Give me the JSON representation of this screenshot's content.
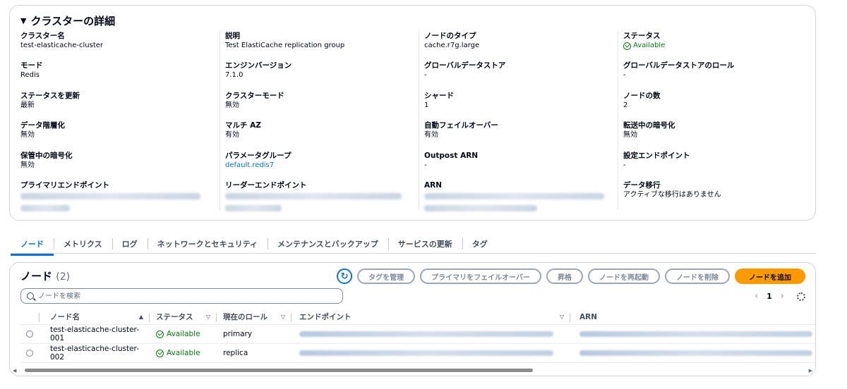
{
  "details": {
    "title": "クラスターの詳細",
    "columns": [
      [
        {
          "label": "クラスター名",
          "value": "test-elasticache-cluster"
        },
        {
          "label": "モード",
          "value": "Redis"
        },
        {
          "label": "ステータスを更新",
          "value": "最新"
        },
        {
          "label": "データ階層化",
          "value": "無効"
        },
        {
          "label": "保管中の暗号化",
          "value": "無効"
        },
        {
          "label": "プライマリエンドポイント",
          "value": ""
        }
      ],
      [
        {
          "label": "説明",
          "value": "Test ElastiCache replication group"
        },
        {
          "label": "エンジンバージョン",
          "value": "7.1.0"
        },
        {
          "label": "クラスターモード",
          "value": "無効"
        },
        {
          "label": "マルチ AZ",
          "value": "有効"
        },
        {
          "label": "パラメータグループ",
          "value": "default.redis7"
        },
        {
          "label": "リーダーエンドポイント",
          "value": ""
        }
      ],
      [
        {
          "label": "ノードのタイプ",
          "value": "cache.r7g.large"
        },
        {
          "label": "グローバルデータストア",
          "value": "-"
        },
        {
          "label": "シャード",
          "value": "1"
        },
        {
          "label": "自動フェイルオーバー",
          "value": "有効"
        },
        {
          "label": "Outpost ARN",
          "value": "-"
        },
        {
          "label": "ARN",
          "value": ""
        }
      ],
      [
        {
          "label": "ステータス",
          "value": "Available"
        },
        {
          "label": "グローバルデータストアのロール",
          "value": "-"
        },
        {
          "label": "ノードの数",
          "value": "2"
        },
        {
          "label": "転送中の暗号化",
          "value": "無効"
        },
        {
          "label": "設定エンドポイント",
          "value": "-"
        },
        {
          "label": "データ移行",
          "value": "アクティブな移行はありません"
        }
      ]
    ]
  },
  "tabs": [
    "ノード",
    "メトリクス",
    "ログ",
    "ネットワークとセキュリティ",
    "メンテナンスとバックアップ",
    "サービスの更新",
    "タグ"
  ],
  "nodes": {
    "title": "ノード",
    "count": "(2)",
    "actions": {
      "manage_tags": "タグを管理",
      "failover": "プライマリをフェイルオーバー",
      "promote": "昇格",
      "reboot": "ノードを再起動",
      "delete": "ノードを削除",
      "add": "ノードを追加"
    },
    "search_placeholder": "ノードを検索",
    "page": "1",
    "headers": {
      "name": "ノード名",
      "status": "ステータス",
      "role": "現在のロール",
      "endpoint": "エンドポイント",
      "arn": "ARN"
    },
    "rows": [
      {
        "name": "test-elasticache-cluster-001",
        "status": "Available",
        "role": "primary"
      },
      {
        "name": "test-elasticache-cluster-002",
        "status": "Available",
        "role": "replica"
      }
    ]
  },
  "colors": {
    "accent": "#0972d3",
    "success": "#037f0c",
    "primary_button": "#ff9900"
  }
}
